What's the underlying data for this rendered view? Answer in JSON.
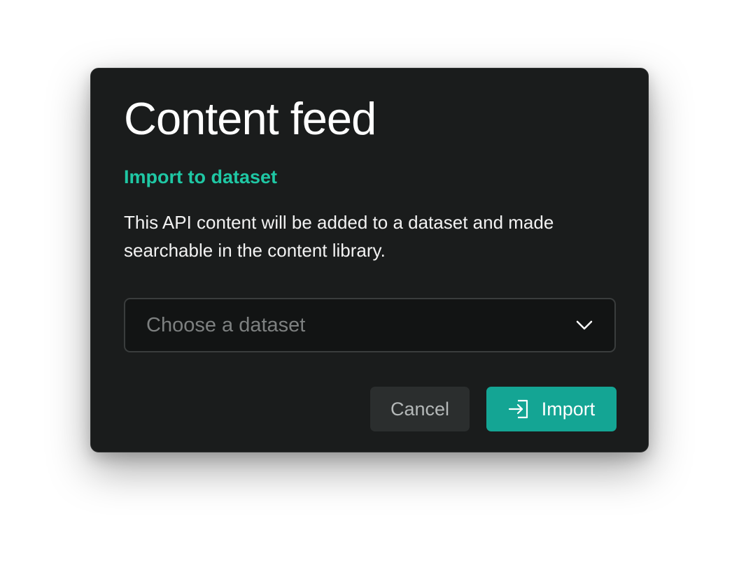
{
  "dialog": {
    "title": "Content feed",
    "subtitle": "Import to dataset",
    "description": "This API content will be added to a dataset and made searchable in the content library.",
    "select": {
      "placeholder": "Choose a dataset",
      "icon": "chevron-down-icon"
    },
    "actions": {
      "cancel_label": "Cancel",
      "import_label": "Import",
      "import_icon": "import-icon"
    }
  },
  "colors": {
    "dialog_background": "#1a1c1c",
    "accent": "#1fc7a4",
    "primary_button": "#14a594",
    "secondary_button": "#2b2e2e"
  }
}
